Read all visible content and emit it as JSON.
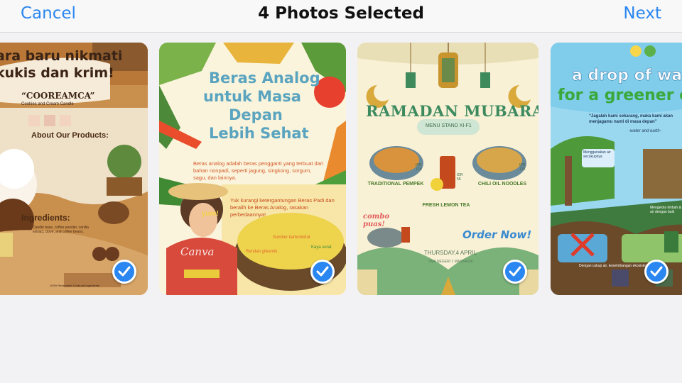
{
  "nav": {
    "cancel": "Cancel",
    "title": "4 Photos Selected",
    "next": "Next"
  },
  "accent_color": "#2a86f0",
  "photos": [
    {
      "headline_1": "ara baru nikmati",
      "headline_2": "kukis dan krim!",
      "brand": "“COOREAMCA”",
      "brand_sub": "Cookies and Cream Candle",
      "about": "About Our Products:",
      "ingredients": "Ingredients:",
      "ingredients_text": "Candle base, coffee powder, vanilla extract, clove, and coffee beans.",
      "footer": "100% Renewable & Natural Ingredients",
      "selected": true,
      "check_icon": "checkmark-icon"
    },
    {
      "title_1": "Beras Analog",
      "title_2": "untuk Masa",
      "title_3": "Depan",
      "title_4": "Lebih Sehat",
      "body": "Beras analog adalah beras pengganti yang terbuat dari bahan nonpadi, seperti jagung, singkong, sorgum, sagu, dan lainnya.",
      "cta": "Yuk kurangi ketergantungan Beras Padi dan beralih ke Beras Analog, rasakan perbedaannya!",
      "yum": "yum!",
      "label_sumber": "Sumber karbohidrat",
      "label_rendah": "Rendah glikemik",
      "label_kaya": "Kaya serat",
      "watermark": "Canva",
      "selected": true,
      "check_icon": "checkmark-icon"
    },
    {
      "title": "RAMADAN MUBARAK",
      "subtitle": "MENU STAND XI-F1",
      "item_1": "TRADITIONAL PEMPEK",
      "item_2": "FRESH LEMON TEA",
      "item_3": "CHILI OIL NOODLES",
      "price_1": "IDR 12K",
      "price_2": "IDR 5K",
      "price_3": "IDR 12K",
      "combo": "combo puas!",
      "order": "Order Now!",
      "date": "THURSDAY,4 APRIL",
      "location": "SMA NEGERI 1 MASBAGIK",
      "selected": true,
      "check_icon": "checkmark-icon"
    },
    {
      "title_1": "a drop of wat",
      "title_2": "for a greener e",
      "quote": "“Jagalah kami sekarang, maka kami akan menjagamu nanti di masa depan”",
      "sign": "-water and earth-",
      "step_1": "Menggunakan air secukupnya",
      "step_2": "Mengelola limbah & air dengan baik",
      "footer": "Dengan cukup air, keseimbangan ekosistem",
      "selected": true,
      "check_icon": "checkmark-icon"
    }
  ]
}
